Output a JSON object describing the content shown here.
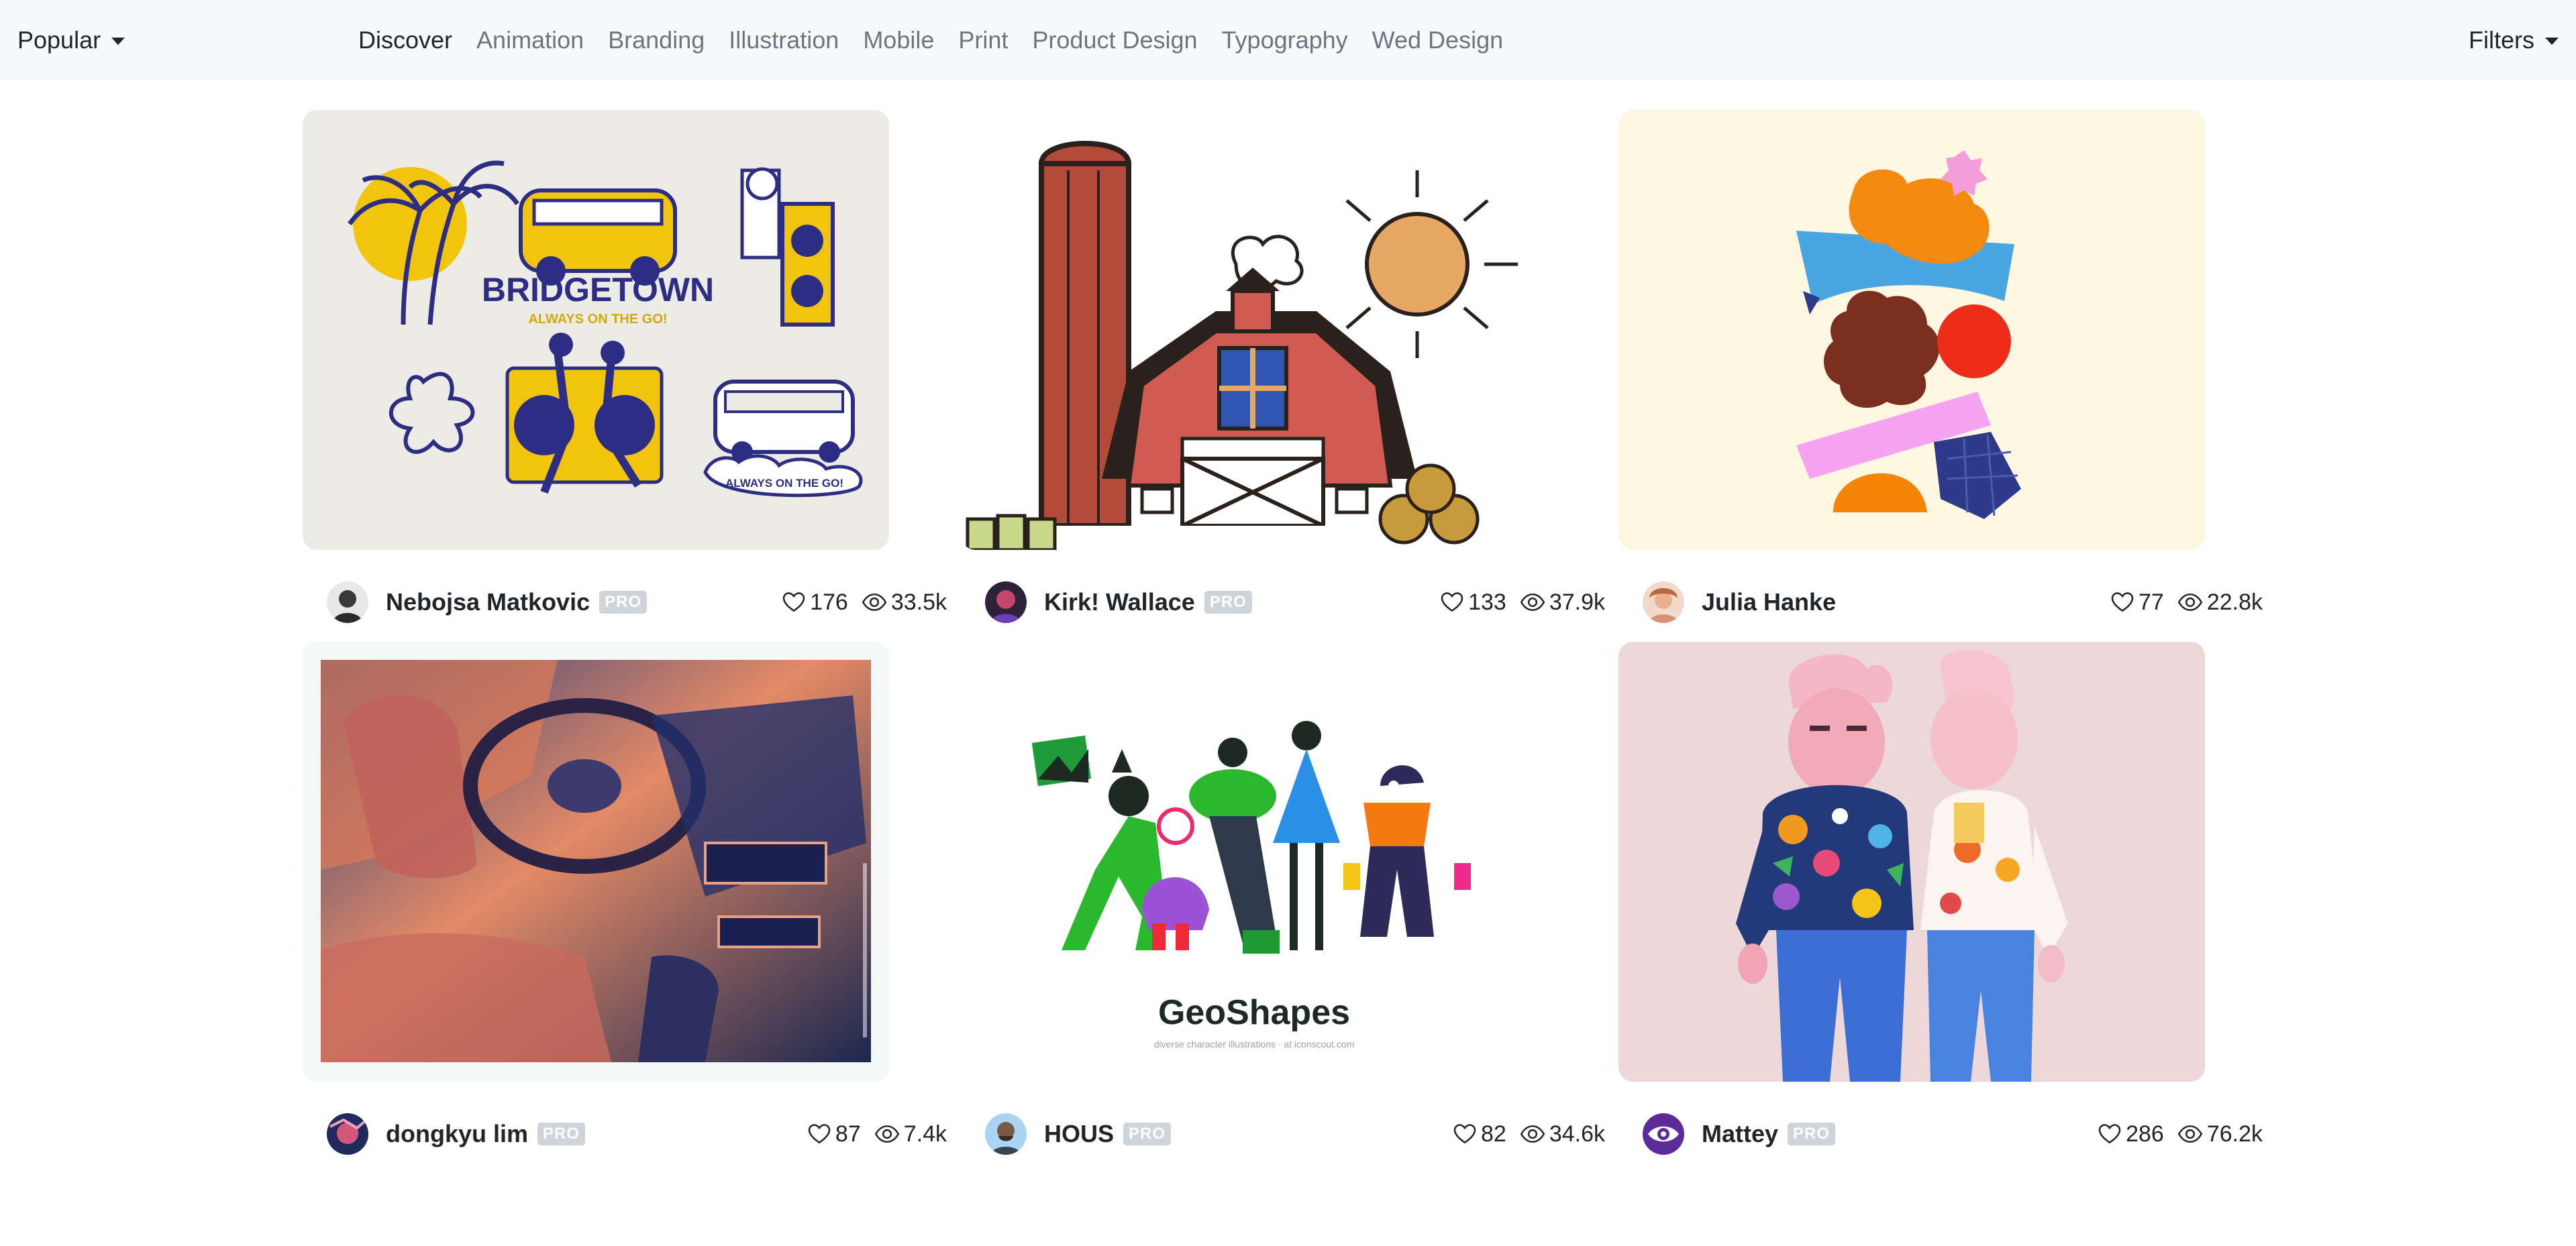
{
  "nav": {
    "sort_label": "Popular",
    "categories": [
      "Discover",
      "Animation",
      "Branding",
      "Illustration",
      "Mobile",
      "Print",
      "Product Design",
      "Typography",
      "Wed Design"
    ],
    "filters_label": "Filters"
  },
  "shots": [
    {
      "author": "Nebojsa Matkovic",
      "pro": "PRO",
      "likes": "176",
      "views": "33.5k",
      "art_text": "BRIDGETOWN",
      "art_subtext": "ALWAYS ON THE GO!",
      "art_subtext2": "ALWAYS ON THE GO!"
    },
    {
      "author": "Kirk! Wallace",
      "pro": "PRO",
      "likes": "133",
      "views": "37.9k"
    },
    {
      "author": "Julia Hanke",
      "likes": "77",
      "views": "22.8k"
    },
    {
      "author": "dongkyu lim",
      "pro": "PRO",
      "likes": "87",
      "views": "7.4k"
    },
    {
      "author": "HOUS",
      "pro": "PRO",
      "likes": "82",
      "views": "34.6k",
      "art_text": "GeoShapes",
      "art_subtext": "diverse character illustrations · at iconscout.com"
    },
    {
      "author": "Mattey",
      "pro": "PRO",
      "likes": "286",
      "views": "76.2k"
    }
  ],
  "icons": {
    "like": "heart-icon",
    "views": "eye-icon",
    "dropdown": "caret-down-icon"
  },
  "colors": {
    "navbar_bg": "#f8f9fa",
    "active_text": "#212529",
    "muted_text": "#6c757d",
    "pro_badge": "#ced4da"
  }
}
